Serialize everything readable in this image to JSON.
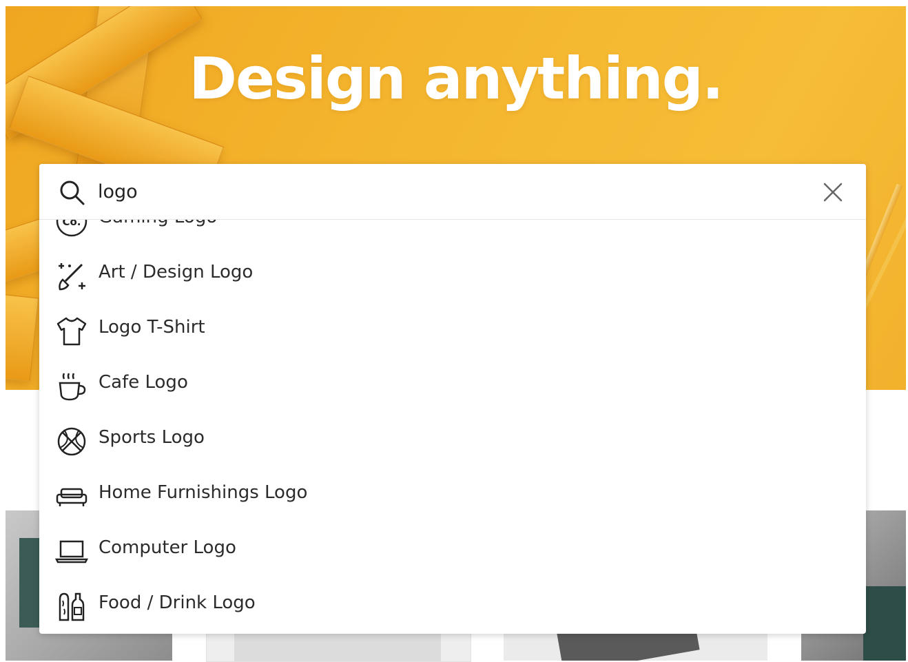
{
  "hero": {
    "title": "Design anything."
  },
  "search": {
    "value": "logo",
    "icon": "search-icon",
    "clear_icon": "close-icon"
  },
  "suggestions": [
    {
      "label": "Gaming Logo",
      "icon": "company-badge-icon"
    },
    {
      "label": "Art / Design Logo",
      "icon": "magic-brush-icon"
    },
    {
      "label": "Logo T-Shirt",
      "icon": "t-shirt-icon"
    },
    {
      "label": "Cafe Logo",
      "icon": "coffee-cup-icon"
    },
    {
      "label": "Sports Logo",
      "icon": "basketball-icon"
    },
    {
      "label": "Home Furnishings Logo",
      "icon": "sofa-icon"
    },
    {
      "label": "Computer Logo",
      "icon": "laptop-icon"
    },
    {
      "label": "Food / Drink Logo",
      "icon": "bread-bottle-icon"
    }
  ],
  "colors": {
    "hero_accent": "#f4b52e",
    "text": "#2b2b2b",
    "panel_bg": "#ffffff"
  }
}
